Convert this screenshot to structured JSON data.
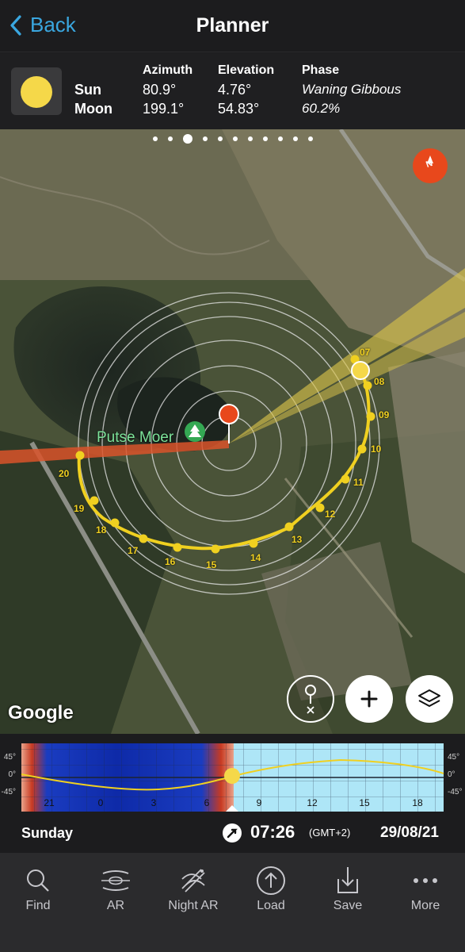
{
  "nav": {
    "back_label": "Back",
    "title": "Planner"
  },
  "info": {
    "headers": {
      "azimuth": "Azimuth",
      "elevation": "Elevation",
      "phase": "Phase"
    },
    "sun": {
      "label": "Sun",
      "azimuth": "80.9°",
      "elevation": "4.76°"
    },
    "moon": {
      "label": "Moon",
      "azimuth": "199.1°",
      "elevation": "54.83°",
      "phase": "Waning Gibbous",
      "illumination": "60.2%"
    }
  },
  "page_indicator": {
    "count": 11,
    "active": 2
  },
  "map": {
    "place_label": "Putse Moer",
    "google_label": "Google",
    "compass_label": "N",
    "hour_labels": [
      "07",
      "08",
      "09",
      "10",
      "11",
      "12",
      "13",
      "14",
      "15",
      "16",
      "17",
      "18",
      "19",
      "20"
    ]
  },
  "timeline": {
    "left_ticks": [
      "45°",
      "0°",
      "-45°"
    ],
    "right_ticks": [
      "45°",
      "0°",
      "-45°"
    ],
    "hours": [
      "21",
      "0",
      "3",
      "6",
      "9",
      "12",
      "15",
      "18"
    ]
  },
  "datebar": {
    "day": "Sunday",
    "time": "07:26",
    "timezone": "(GMT+2)",
    "date": "29/08/21"
  },
  "tabs": [
    {
      "label": "Find",
      "icon": "search-icon"
    },
    {
      "label": "AR",
      "icon": "ar-icon"
    },
    {
      "label": "Night AR",
      "icon": "night-ar-icon"
    },
    {
      "label": "Load",
      "icon": "load-icon"
    },
    {
      "label": "Save",
      "icon": "save-icon"
    },
    {
      "label": "More",
      "icon": "more-icon"
    }
  ],
  "colors": {
    "accent": "#3aa7e0",
    "sun": "#f5d849",
    "sun_path": "#f0d020",
    "moon_line": "#e05020",
    "pin": "#e8481c"
  }
}
